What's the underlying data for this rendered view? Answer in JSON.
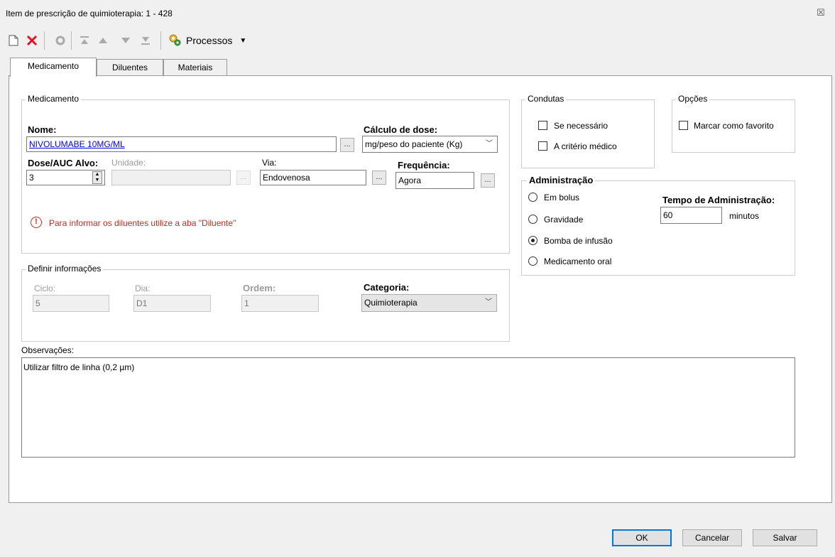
{
  "window": {
    "title": "Item de prescrição de quimioterapia: 1 - 428",
    "close_glyph": "☒"
  },
  "toolbar": {
    "processos_label": "Processos"
  },
  "tabs": [
    {
      "label": "Medicamento"
    },
    {
      "label": "Diluentes"
    },
    {
      "label": "Materiais"
    }
  ],
  "medicamento": {
    "group_label": "Medicamento",
    "nome_label": "Nome:",
    "nome_value": "NIVOLUMABE 10MG/ML",
    "calculo_label": "Cálculo de dose:",
    "calculo_value": "mg/peso do paciente (Kg)",
    "dose_label": "Dose/AUC Alvo:",
    "dose_value": "3",
    "unidade_label": "Unidade:",
    "unidade_value": "",
    "via_label": "Via:",
    "via_value": "Endovenosa",
    "frequencia_label": "Frequência:",
    "frequencia_value": "Agora",
    "warning_text": "Para informar os diluentes utilize a aba \"Diluente\"",
    "browse_label": "..."
  },
  "definir": {
    "group_label": "Definir informações",
    "ciclo_label": "Ciclo:",
    "ciclo_value": "5",
    "dia_label": "Dia:",
    "dia_value": "D1",
    "ordem_label": "Ordem:",
    "ordem_value": "1",
    "categoria_label": "Categoria:",
    "categoria_value": "Quimioterapia"
  },
  "condutas": {
    "group_label": "Condutas",
    "se_necessario": "Se necessário",
    "criterio_medico": "A critério médico"
  },
  "opcoes": {
    "group_label": "Opções",
    "favorito": "Marcar como favorito"
  },
  "administracao": {
    "group_label": "Administração",
    "options": [
      "Em bolus",
      "Gravidade",
      "Bomba de infusão",
      "Medicamento oral"
    ],
    "selected": "Bomba de infusão",
    "tempo_label": "Tempo de Administração:",
    "tempo_value": "60",
    "tempo_unit": "minutos"
  },
  "observacoes": {
    "label": "Observações:",
    "value": "Utilizar filtro de linha (0,2 µm)"
  },
  "footer": {
    "ok": "OK",
    "cancelar": "Cancelar",
    "salvar": "Salvar"
  },
  "colors": {
    "accent": "#0078d7",
    "delete_red": "#e81123",
    "warning_red": "#c42b1c",
    "link_blue": "#0000ee"
  }
}
